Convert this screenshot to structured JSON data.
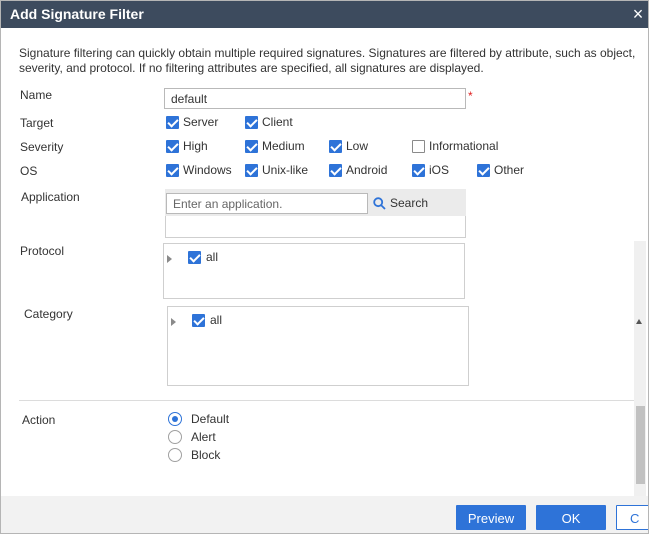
{
  "dialog": {
    "title": "Add Signature Filter",
    "close_icon": "close-icon",
    "description": "Signature filtering can quickly obtain multiple required signatures. Signatures are filtered by attribute, such as object, severity, and protocol. If no filtering attributes are specified, all signatures are displayed."
  },
  "form": {
    "name": {
      "label": "Name",
      "value": "default",
      "required_mark": "*"
    },
    "target": {
      "label": "Target",
      "options": [
        {
          "label": "Server",
          "checked": true
        },
        {
          "label": "Client",
          "checked": true
        }
      ]
    },
    "severity": {
      "label": "Severity",
      "options": [
        {
          "label": "High",
          "checked": true
        },
        {
          "label": "Medium",
          "checked": true
        },
        {
          "label": "Low",
          "checked": true
        },
        {
          "label": "Informational",
          "checked": false
        }
      ]
    },
    "os": {
      "label": "OS",
      "options": [
        {
          "label": "Windows",
          "checked": true
        },
        {
          "label": "Unix-like",
          "checked": true
        },
        {
          "label": "Android",
          "checked": true
        },
        {
          "label": "iOS",
          "checked": true
        },
        {
          "label": "Other",
          "checked": true
        }
      ]
    },
    "application": {
      "label": "Application",
      "placeholder": "Enter an application.",
      "search_label": "Search",
      "search_icon": "search-icon"
    },
    "protocol": {
      "label": "Protocol",
      "tree": [
        {
          "label": "all",
          "checked": true,
          "expand_icon": "caret-right-icon"
        }
      ]
    },
    "category": {
      "label": "Category",
      "tree": [
        {
          "label": "all",
          "checked": true,
          "expand_icon": "caret-right-icon"
        }
      ]
    },
    "action": {
      "label": "Action",
      "options": [
        {
          "label": "Default",
          "selected": true
        },
        {
          "label": "Alert",
          "selected": false
        },
        {
          "label": "Block",
          "selected": false
        }
      ]
    }
  },
  "footer": {
    "preview_label": "Preview",
    "ok_label": "OK",
    "cancel_label": "C"
  },
  "colors": {
    "title_bar": "#3d4b5e",
    "accent": "#2e73d8",
    "required": "#e02020"
  }
}
